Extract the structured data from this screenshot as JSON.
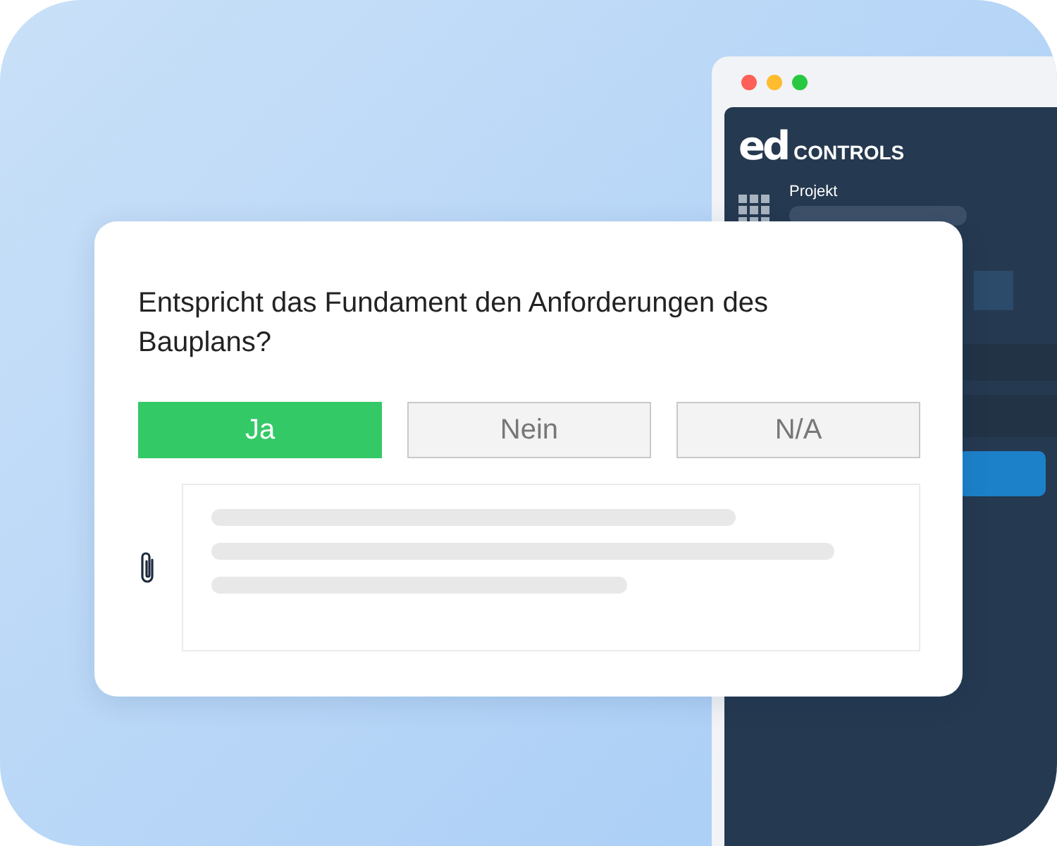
{
  "app": {
    "logo": "ed",
    "brand": "CONTROLS",
    "project_label": "Projekt"
  },
  "dialog": {
    "question": "Entspricht das Fundament den Anforderungen des Bauplans?",
    "options": [
      {
        "label": "Ja",
        "selected": true
      },
      {
        "label": "Nein",
        "selected": false
      },
      {
        "label": "N/A",
        "selected": false
      }
    ]
  }
}
